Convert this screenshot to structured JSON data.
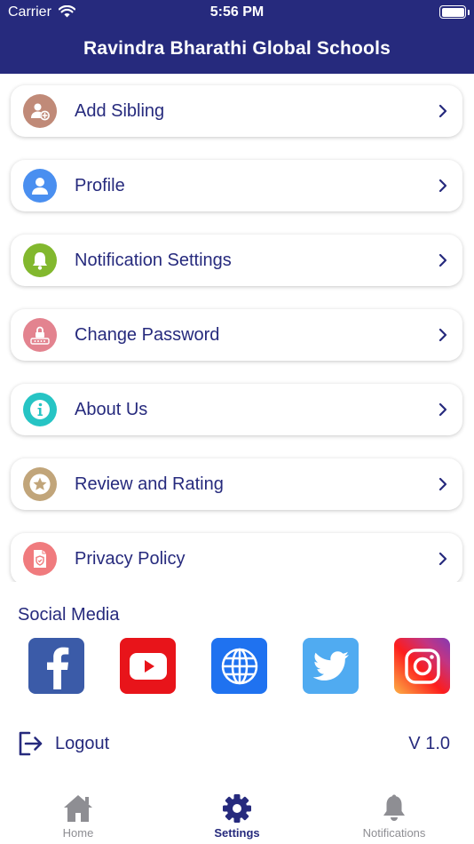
{
  "status_bar": {
    "carrier": "Carrier",
    "time": "5:56 PM"
  },
  "header": {
    "title": "Ravindra Bharathi Global Schools"
  },
  "menu": [
    {
      "label": "Add Sibling",
      "icon": "add-user-icon",
      "color": "#c08a78"
    },
    {
      "label": "Profile",
      "icon": "person-icon",
      "color": "#4a8ff0"
    },
    {
      "label": "Notification Settings",
      "icon": "bell-icon",
      "color": "#82b82e"
    },
    {
      "label": "Change Password",
      "icon": "lock-icon",
      "color": "#e3838f"
    },
    {
      "label": "About Us",
      "icon": "info-icon",
      "color": "#26c4c4"
    },
    {
      "label": "Review and Rating",
      "icon": "star-icon",
      "color": "#c1a57a"
    },
    {
      "label": "Privacy Policy",
      "icon": "shield-document-icon",
      "color": "#f07b7e"
    }
  ],
  "social": {
    "title": "Social Media",
    "items": [
      {
        "name": "facebook",
        "icon": "facebook-icon",
        "color": "#3b5ba8"
      },
      {
        "name": "youtube",
        "icon": "youtube-icon",
        "color": "#e8141a"
      },
      {
        "name": "website",
        "icon": "globe-icon",
        "color": "#1f72f0"
      },
      {
        "name": "twitter",
        "icon": "twitter-icon",
        "color": "#50abf1"
      },
      {
        "name": "instagram",
        "icon": "instagram-icon",
        "color": "#d62977"
      }
    ]
  },
  "footer": {
    "logout_label": "Logout",
    "version": "V 1.0"
  },
  "tabbar": {
    "home_label": "Home",
    "settings_label": "Settings",
    "notifications_label": "Notifications",
    "active_color": "#262a7d",
    "inactive_color": "#8e8e93"
  }
}
